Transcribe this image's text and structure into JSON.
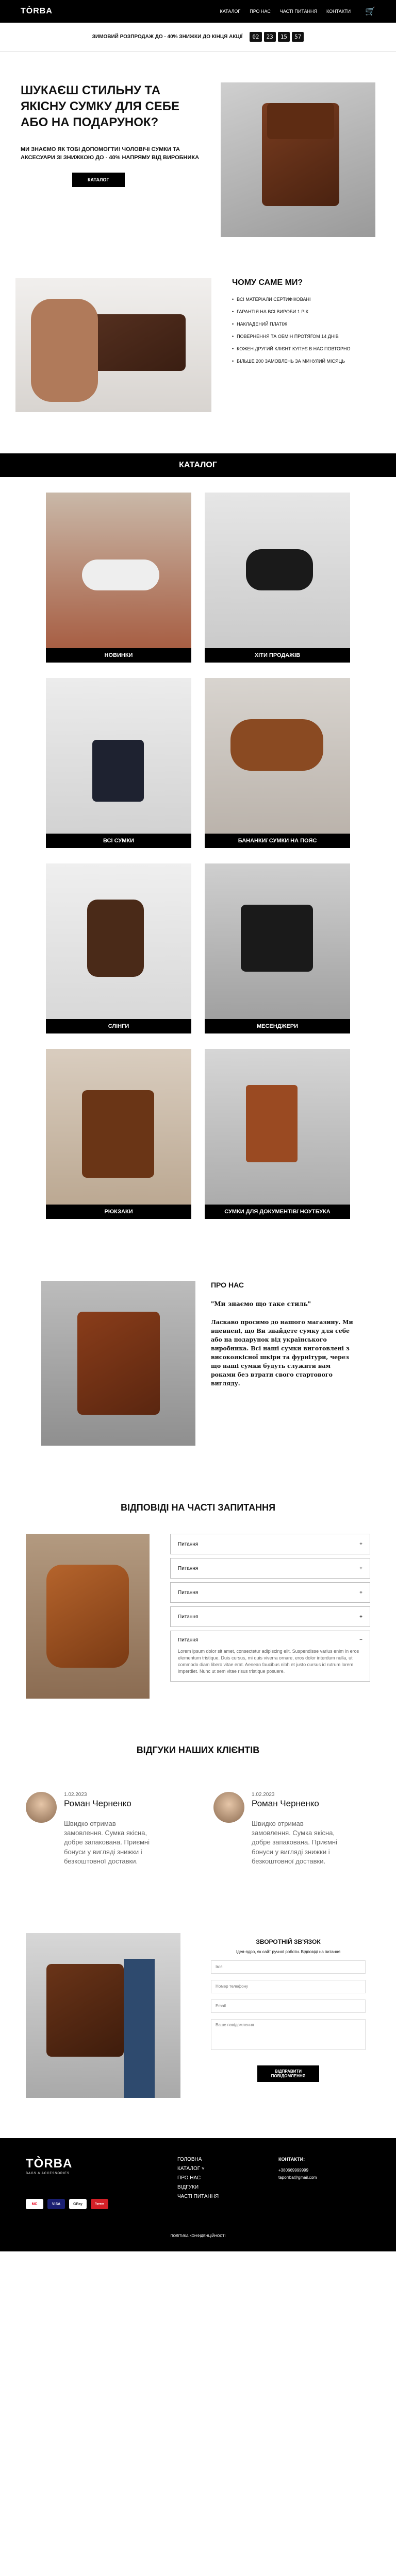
{
  "header": {
    "logo": "TÒRBA",
    "nav": [
      "КАТАЛОГ",
      "ПРО НАС",
      "ЧАСТІ ПИТАННЯ",
      "КОНТАКТИ"
    ]
  },
  "salebar": {
    "text": "ЗИМОВИЙ РОЗПРОДАЖ ДО - 40% ЗНИЖКИ ДО КІНЦЯ АКЦІЇ",
    "timer": [
      "02",
      "23",
      "15",
      "57"
    ]
  },
  "hero": {
    "title": "ШУКАЄШ СТИЛЬНУ ТА ЯКІСНУ СУМКУ ДЛЯ СЕБЕ АБО НА ПОДАРУНОК?",
    "subtitle": "МИ ЗНАЄМО ЯК ТОБІ ДОПОМОГТИ! ЧОЛОВІЧІ СУМКИ ТА АКСЕСУАРИ ЗІ ЗНИЖКОЮ ДО - 40% НАПРЯМУ ВІД ВИРОБНИКА",
    "button": "КАТАЛОГ"
  },
  "why": {
    "title": "ЧОМУ САМЕ МИ?",
    "items": [
      "ВСІ МАТЕРІАЛИ СЕРТИФІКОВАНІ",
      "ГАРАНТІЯ НА ВСІ ВИРОБИ 1 РІК",
      "НАКЛАДЕНИЙ ПЛАТІЖ",
      "ПОВЕРНЕННЯ ТА ОБМІН ПРОТЯГОМ 14 ДНІВ",
      "КОЖЕН ДРУГИЙ КЛІЄНТ КУПУЄ В НАС ПОВТОРНО",
      "БІЛЬШЕ 200 ЗАМОВЛЕНЬ ЗА МИНУЛИЙ МІСЯЦЬ"
    ]
  },
  "catalog": {
    "title": "КАТАЛОГ",
    "cards": [
      "НОВИНКИ",
      "ХІТИ ПРОДАЖІВ",
      "ВСІ СУМКИ",
      "БАНАНКИ/ СУМКИ НА ПОЯС",
      "СЛІНГИ",
      "МЕСЕНДЖЕРИ",
      "РЮКЗАКИ",
      "СУМКИ ДЛЯ ДОКУМЕНТІВ/ НОУТБУКА"
    ]
  },
  "about": {
    "title": "ПРО НАС",
    "quote": "\"Ми знаємо що таке стиль\"",
    "text": "Ласкаво просимо до нашого магазину. Ми впевнені, що Ви знайдете сумку для себе або на подарунок від українського виробника. Всі наші сумки виготовлені з високоякісної шкіри та фурнітури, через що наші сумки будуть служити вам роками без втрати свого стартового вигляду."
  },
  "faq": {
    "title": "ВІДПОВІДІ НА ЧАСТІ ЗАПИТАННЯ",
    "items": [
      "Питання",
      "Питання",
      "Питання",
      "Питання"
    ],
    "open_question": "Питання",
    "open_answer": "Lorem ipsum dolor sit amet, consectetur adipiscing elit. Suspendisse varius enim in eros elementum tristique. Duis cursus, mi quis viverra ornare, eros dolor interdum nulla, ut commodo diam libero vitae erat. Aenean faucibus nibh et justo cursus id rutrum lorem imperdiet. Nunc ut sem vitae risus tristique posuere."
  },
  "reviews": {
    "title": "ВІДГУКИ НАШИХ КЛІЄНТІВ",
    "items": [
      {
        "date": "1.02.2023",
        "name": "Роман Черненко",
        "text": "Швидко отримав замовлення. Сумка якісна, добре запакована. Приємні бонуси у вигляді знижки і безкоштовної доставки."
      },
      {
        "date": "1.02.2023",
        "name": "Роман Черненко",
        "text": "Швидко отримав замовлення. Сумка якісна, добре запакована. Приємні бонуси у вигляді знижки і безкоштовної доставки."
      }
    ]
  },
  "feedback": {
    "title": "ЗВОРОТНІЙ ЗВ'ЯЗОК",
    "desc": "Ідея-ядро, як сайт ручної роботи. Відповіді на питання",
    "fields": [
      "Ім'я",
      "Номер телефону",
      "Email"
    ],
    "textarea": "Ваше повідомлення",
    "button": "ВІДПРАВИТИ ПОВІДОМЛЕННЯ"
  },
  "footer": {
    "logo": "TÒRBA",
    "tagline": "BAGS & ACCESSORIES",
    "nav": [
      "ГОЛОВНА",
      "КАТАЛОГ ˅",
      "ПРО НАС",
      "ВІДГУКИ",
      "ЧАСТІ ПИТАННЯ"
    ],
    "contacts_title": "КОНТАКТИ:",
    "phone": "+380669999999",
    "email": "taporrba@gmail.com",
    "policy": "ПОЛІТИКА КОНФІДЕНЦІЙНОСТІ",
    "payments": [
      "MC",
      "VISA",
      "GPay",
      "Приват"
    ]
  }
}
